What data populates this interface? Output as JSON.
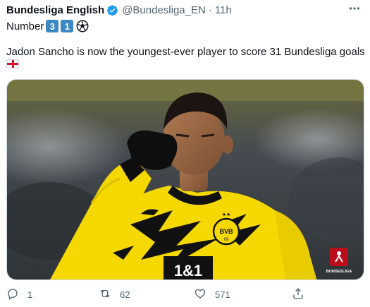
{
  "tweet": {
    "author_name": "Bundesliga English",
    "handle": "@Bundesliga_EN",
    "separator": "·",
    "time": "11h",
    "line1_text": "Number",
    "keycaps": [
      "3",
      "1"
    ],
    "body_text": "Jadon Sancho is now the youngest-ever player to score 31 Bundesliga goals",
    "media": {
      "jersey_sponsor": "1&1",
      "crest_text": "BVB",
      "crest_year": "09",
      "watermark_text": "BUNDESLIGA"
    }
  },
  "actions": {
    "reply_count": "1",
    "retweet_count": "62",
    "like_count": "571"
  },
  "colors": {
    "verified": "#1d9bf0",
    "keycap": "#3b88c3",
    "jersey": "#f5d800",
    "muted": "#536471"
  },
  "icons": [
    "verified-badge-icon",
    "more-icon",
    "soccer-ball-icon",
    "england-flag-icon",
    "reply-icon",
    "retweet-icon",
    "like-icon",
    "share-icon"
  ]
}
